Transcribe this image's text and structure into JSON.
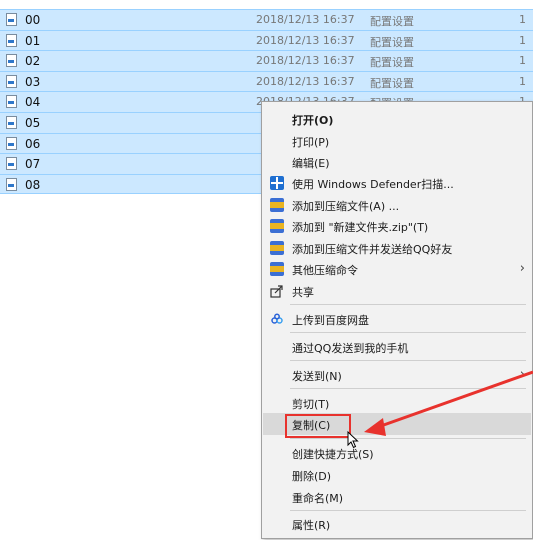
{
  "files": [
    {
      "name": "00",
      "date": "2018/12/13 16:37",
      "type": "配置设置",
      "size": "1"
    },
    {
      "name": "01",
      "date": "2018/12/13 16:37",
      "type": "配置设置",
      "size": "1"
    },
    {
      "name": "02",
      "date": "2018/12/13 16:37",
      "type": "配置设置",
      "size": "1"
    },
    {
      "name": "03",
      "date": "2018/12/13 16:37",
      "type": "配置设置",
      "size": "1"
    },
    {
      "name": "04",
      "date": "2018/12/13 16:37",
      "type": "配置设置",
      "size": "1"
    },
    {
      "name": "05",
      "date": "",
      "type": "",
      "size": ""
    },
    {
      "name": "06",
      "date": "",
      "type": "",
      "size": ""
    },
    {
      "name": "07",
      "date": "",
      "type": "",
      "size": ""
    },
    {
      "name": "08",
      "date": "",
      "type": "",
      "size": ""
    }
  ],
  "menu": {
    "open": "打开(O)",
    "print": "打印(P)",
    "edit": "编辑(E)",
    "defender": "使用 Windows Defender扫描...",
    "add_archive": "添加到压缩文件(A) ...",
    "add_zip": "添加到 \"新建文件夹.zip\"(T)",
    "add_send_qq": "添加到压缩文件并发送给QQ好友",
    "other_compress": "其他压缩命令",
    "share": "共享",
    "baidu_upload": "上传到百度网盘",
    "qq_send_phone": "通过QQ发送到我的手机",
    "send_to": "发送到(N)",
    "cut": "剪切(T)",
    "copy": "复制(C)",
    "create_shortcut": "创建快捷方式(S)",
    "delete": "删除(D)",
    "rename": "重命名(M)",
    "properties": "属性(R)"
  },
  "icons": {
    "file": "file-icon",
    "defender": "shield-icon",
    "archive": "archive-icon",
    "share": "share-icon",
    "baidu": "cloud-icon",
    "submenu": "chevron-right-icon"
  },
  "colors": {
    "selection": "#cce8ff",
    "menu_bg": "#f2f2f2",
    "annotation": "#e8322d"
  }
}
